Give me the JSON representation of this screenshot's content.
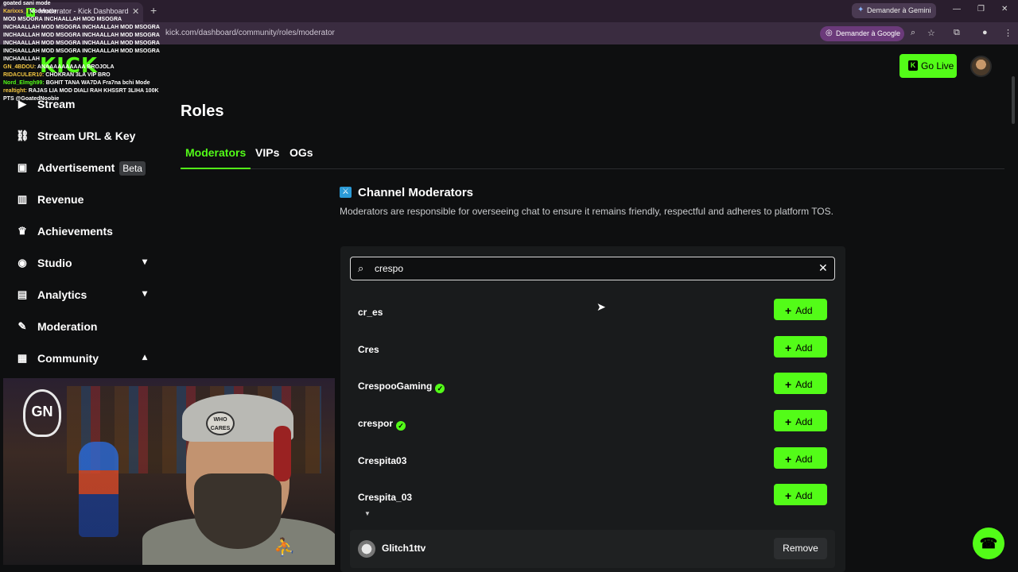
{
  "browser": {
    "tab_title": "Moderator - Kick Dashboard",
    "tab_close": "✕",
    "new_tab": "+",
    "gemini_label": "Demander à Gemini",
    "url": "kick.com/dashboard/community/roles/moderator",
    "google_label": "Demander à Google",
    "window_controls": [
      "—",
      "❐",
      "✕"
    ]
  },
  "header": {
    "logo": "KICK",
    "go_live": "Go Live"
  },
  "sidebar": {
    "items": [
      {
        "label": "Stream",
        "icon": "play-icon"
      },
      {
        "label": "Stream URL & Key",
        "icon": "link-icon"
      },
      {
        "label": "Advertisement",
        "badge": "Beta",
        "icon": "ad-icon"
      },
      {
        "label": "Revenue",
        "icon": "chart-icon"
      },
      {
        "label": "Achievements",
        "icon": "trophy-icon"
      },
      {
        "label": "Studio",
        "icon": "studio-icon",
        "chevron": "down"
      },
      {
        "label": "Analytics",
        "icon": "analytics-icon",
        "chevron": "down"
      },
      {
        "label": "Moderation",
        "icon": "wrench-icon"
      },
      {
        "label": "Community",
        "icon": "community-icon",
        "chevron": "up"
      }
    ]
  },
  "chat_overlay": [
    {
      "user": "",
      "text": "goated sani mode"
    },
    {
      "user": "Karixxs_I",
      "text": "Moderator"
    },
    {
      "user": "",
      "text": "MOD MSOGRA INCHAALLAH MOD MSOGRA"
    },
    {
      "user": "",
      "text": "INCHAALLAH MOD MSOGRA INCHAALLAH MOD MSOGRA"
    },
    {
      "user": "",
      "text": "INCHAALLAH MOD MSOGRA INCHAALLAH MOD MSOGRA"
    },
    {
      "user": "",
      "text": "INCHAALLAH MOD MSOGRA INCHAALLAH MOD MSOGRA"
    },
    {
      "user": "",
      "text": "INCHAALLAH MOD MSOGRA INCHAALLAH MOD MSOGRA"
    },
    {
      "user": "",
      "text": "INCHAALLAH"
    },
    {
      "user": "GN_4BDOU:",
      "text": "ANAAAAAAAAAA BROJOLA"
    },
    {
      "user": "RIDACULER10:",
      "text": "CHOKRAN 3LA VIP BRO"
    },
    {
      "user": "Nord_Elmgh99:",
      "text": "BGHIT TANA WA7DA Fra7na bchi Mode"
    },
    {
      "user": "realtight:",
      "text": "RAJAS LIA MOD DIALI RAH KHSSRT 3LIHA 100K"
    },
    {
      "user": "",
      "text": "PTS @GoatedNoobie"
    }
  ],
  "main": {
    "title": "Roles",
    "tabs": [
      "Moderators",
      "VIPs",
      "OGs"
    ],
    "section_title": "Channel Moderators",
    "section_desc": "Moderators are responsible for overseeing chat to ensure it remains friendly, respectful and adheres to platform TOS.",
    "search": {
      "value": "crespo",
      "placeholder": "Search"
    },
    "results": [
      {
        "name": "cr_es",
        "verified": false
      },
      {
        "name": "Cres",
        "verified": false
      },
      {
        "name": "CrespooGaming",
        "verified": true
      },
      {
        "name": "crespor",
        "verified": true
      },
      {
        "name": "Crespita03",
        "verified": false
      },
      {
        "name": "Crespita_03",
        "verified": false
      }
    ],
    "add_label": "Add",
    "moderators": [
      {
        "name": "Glitch1ttv",
        "action": "Remove"
      }
    ]
  },
  "webcam": {
    "logo_text": "GN",
    "cap_text": "WHO CARES"
  },
  "colors": {
    "accent": "#53fc18",
    "background": "#0e0f10",
    "panel": "#191b1c"
  }
}
